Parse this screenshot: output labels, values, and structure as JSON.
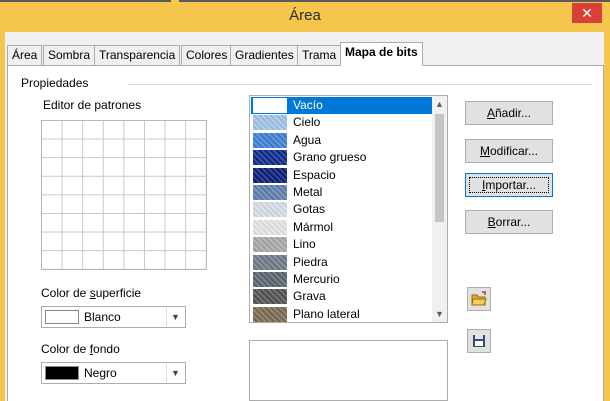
{
  "window": {
    "title": "Área",
    "close_glyph": "✕"
  },
  "tabs": [
    {
      "label": "Área",
      "active": false
    },
    {
      "label": "Sombra",
      "active": false
    },
    {
      "label": "Transparencia",
      "active": false
    },
    {
      "label": "Colores",
      "active": false
    },
    {
      "label": "Gradientes",
      "active": false
    },
    {
      "label": "Trama",
      "active": false
    },
    {
      "label": "Mapa de bits",
      "active": true
    }
  ],
  "section": {
    "title": "Propiedades"
  },
  "pattern_editor": {
    "label": "Editor de patrones"
  },
  "surface_color": {
    "label_pre": "Color de ",
    "label_underlined": "s",
    "label_post": "uperficie",
    "value": "Blanco",
    "swatch": "#ffffff"
  },
  "background_color": {
    "label_pre": "Color de ",
    "label_underlined": "f",
    "label_post": "ondo",
    "value": "Negro",
    "swatch": "#000000"
  },
  "bitmap_list": {
    "selected_index": 0,
    "items": [
      {
        "label": "Vacío",
        "texture": "#ffffff"
      },
      {
        "label": "Cielo",
        "texture": "#9fc4ea"
      },
      {
        "label": "Agua",
        "texture": "#3f7fd8"
      },
      {
        "label": "Grano grueso",
        "texture": "#0e2a8c"
      },
      {
        "label": "Espacio",
        "texture": "#0a1f78"
      },
      {
        "label": "Metal",
        "texture": "#5d7fae"
      },
      {
        "label": "Gotas",
        "texture": "#d6dde8"
      },
      {
        "label": "Mármol",
        "texture": "#e4e4e4"
      },
      {
        "label": "Lino",
        "texture": "#a9a9a9"
      },
      {
        "label": "Piedra",
        "texture": "#6f7a88"
      },
      {
        "label": "Mercurio",
        "texture": "#5a6570"
      },
      {
        "label": "Grava",
        "texture": "#535353"
      },
      {
        "label": "Plano lateral",
        "texture": "#7d6a52"
      }
    ]
  },
  "buttons": {
    "add": {
      "pre": "",
      "u": "A",
      "post": "ñadir..."
    },
    "modify": {
      "pre": "",
      "u": "M",
      "post": "odificar..."
    },
    "import": {
      "pre": "",
      "u": "I",
      "post": "mportar..."
    },
    "delete": {
      "pre": "",
      "u": "B",
      "post": "orrar..."
    }
  },
  "icons": {
    "open": "folder-open-icon",
    "save": "floppy-save-icon"
  },
  "colors": {
    "titlebar": "#f6c64c",
    "close": "#d9403a",
    "selection": "#0078d7"
  }
}
